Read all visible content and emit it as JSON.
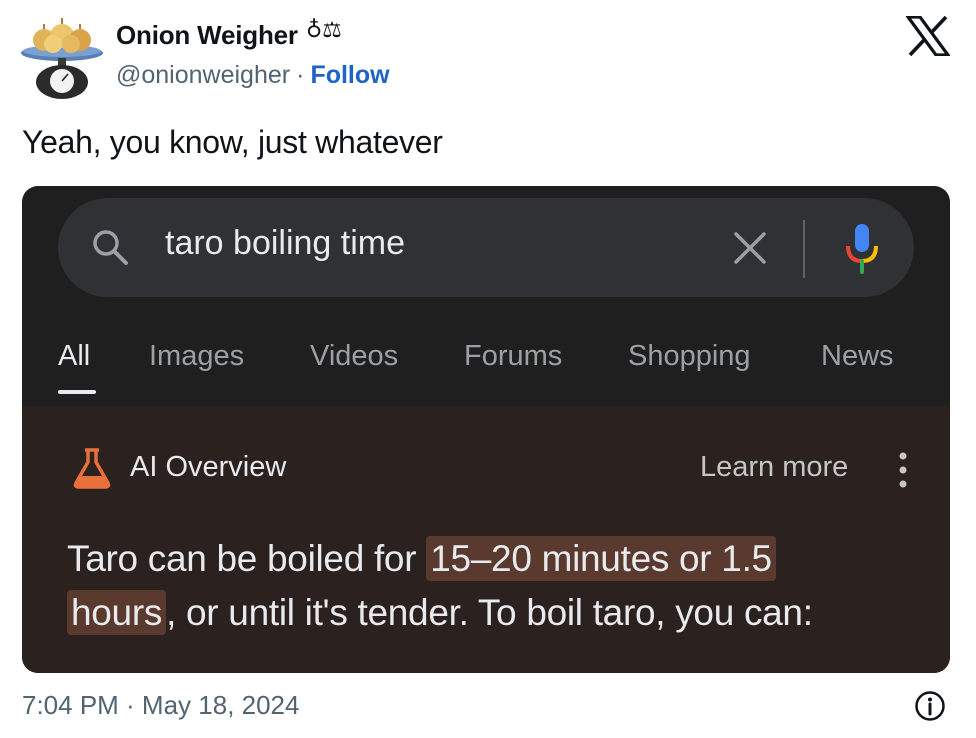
{
  "author": {
    "name": "Onion Weigher",
    "emoji": "♁⚖",
    "handle": "@onionweigher",
    "separator": "·",
    "follow_label": "Follow"
  },
  "tweet": {
    "text": "Yeah, you know, just whatever",
    "timestamp": "7:04 PM · May 18, 2024"
  },
  "screenshot": {
    "search": {
      "query": "taro boiling time"
    },
    "tabs": [
      {
        "label": "All",
        "active": true
      },
      {
        "label": "Images",
        "active": false
      },
      {
        "label": "Videos",
        "active": false
      },
      {
        "label": "Forums",
        "active": false
      },
      {
        "label": "Shopping",
        "active": false
      },
      {
        "label": "News",
        "active": false
      }
    ],
    "ai_overview": {
      "title": "AI Overview",
      "learn_more": "Learn more",
      "body_prefix": "Taro can be boiled for ",
      "body_highlight_1": "15–20 minutes or 1.5",
      "body_highlight_2": "hours",
      "body_suffix": ", or until it's tender. To boil taro, you can:"
    }
  },
  "icons": {
    "x_logo": "x-logo-icon",
    "search": "search-icon",
    "clear": "close-icon",
    "mic": "microphone-icon",
    "lab": "flask-icon",
    "more": "more-vertical-icon",
    "info": "info-icon"
  },
  "colors": {
    "follow": "#1d63c8",
    "media_bg": "#1f1f1f",
    "ai_panel_bg": "#2b2220",
    "highlight": "#5a3a2e",
    "flask": "#e8703a"
  }
}
